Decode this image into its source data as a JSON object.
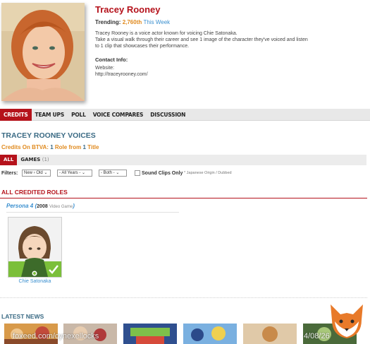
{
  "profile": {
    "name": "Tracey Rooney",
    "trending_label": "Trending:",
    "trending_rank": "2,760th",
    "trending_period": "This Week",
    "bio_line1": "Tracey Rooney is a voice actor known for voicing Chie Satonaka.",
    "bio_line2": "Take a visual walk through their career and see 1 image of the character they've voiced and listen",
    "bio_line3": "to 1 clip that showcases their performance.",
    "contact_title": "Contact Info:",
    "website_label": "Website:",
    "website_url": "http://traceyrooney.com/"
  },
  "tabs": [
    "CREDITS",
    "TEAM UPS",
    "POLL",
    "VOICE COMPARES",
    "DISCUSSION"
  ],
  "voices": {
    "title": "TRACEY ROONEY VOICES",
    "credits_prefix": "Credits On BTVA:",
    "roles_count": "1",
    "roles_text": "Role from",
    "titles_count": "1",
    "titles_text": "Title"
  },
  "subtabs": {
    "all": "ALL",
    "games": "GAMES",
    "games_count": "(1)"
  },
  "filters": {
    "label": "Filters:",
    "sort": "New › Old",
    "years": "- All Years -",
    "both": "- Both -",
    "clips_label": "Sound Clips Only",
    "note": "* Japanese Origin / Dubbed"
  },
  "roles": {
    "title": "ALL CREDITED ROLES",
    "game_title": "Persona 4",
    "game_year": "2008",
    "game_kind": "Video Game",
    "character_name": "Chie Satonaka"
  },
  "news": {
    "title": "LATEST NEWS"
  },
  "watermark": {
    "text": "foxeed.com/cynexellocks",
    "date": "4/08/26"
  },
  "colors": {
    "brand_red": "#b5121b",
    "link_blue": "#3a8fcf",
    "accent_orange": "#e08a1e",
    "heading_teal": "#3a6a84"
  }
}
